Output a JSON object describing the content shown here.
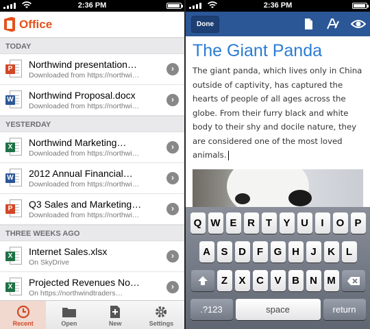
{
  "status_left": {
    "time": "2:36 PM"
  },
  "status_right": {
    "time": "2:36 PM"
  },
  "office": {
    "title": "Office",
    "brand_color": "#e4511b",
    "sections": [
      {
        "label": "TODAY",
        "items": [
          {
            "type": "powerpoint",
            "badge": "P",
            "title": "Northwind presentation…",
            "subtitle": "Downloaded from https://northwi…"
          },
          {
            "type": "word",
            "badge": "W",
            "title": "Northwind Proposal.docx",
            "subtitle": "Downloaded from https://northwi…"
          }
        ]
      },
      {
        "label": "YESTERDAY",
        "items": [
          {
            "type": "excel",
            "badge": "X",
            "title": "Northwind Marketing…",
            "subtitle": "Downloaded from https://northwi…"
          },
          {
            "type": "word",
            "badge": "W",
            "title": "2012 Annual Financial…",
            "subtitle": "Downloaded from https://northwi…"
          },
          {
            "type": "powerpoint",
            "badge": "P",
            "title": "Q3 Sales and Marketing…",
            "subtitle": "Downloaded from https://northwi…"
          }
        ]
      },
      {
        "label": "THREE WEEKS AGO",
        "items": [
          {
            "type": "excel",
            "badge": "X",
            "title": "Internet Sales.xlsx",
            "subtitle": "On SkyDrive"
          },
          {
            "type": "excel",
            "badge": "X",
            "title": "Projected Revenues No…",
            "subtitle": "On https://northwindtraders…"
          }
        ]
      }
    ],
    "tabs": [
      {
        "label": "Recent",
        "icon": "clock-icon",
        "active": true
      },
      {
        "label": "Open",
        "icon": "folder-icon",
        "active": false
      },
      {
        "label": "New",
        "icon": "new-document-icon",
        "active": false
      },
      {
        "label": "Settings",
        "icon": "gear-icon",
        "active": false
      }
    ]
  },
  "word": {
    "done_label": "Done",
    "toolbar_icons": [
      "document-icon",
      "font-format-icon",
      "eye-icon"
    ],
    "title": "The Giant Panda",
    "body": "The giant panda, which lives only in China outside of captivity, has captured the hearts of people of all ages across the globe. From their furry black and white body to their shy and docile nature, they are considered one of the most loved animals.",
    "header_color": "#2b5797",
    "title_color": "#2b7cd3"
  },
  "keyboard": {
    "row1": [
      "Q",
      "W",
      "E",
      "R",
      "T",
      "Y",
      "U",
      "I",
      "O",
      "P"
    ],
    "row2": [
      "A",
      "S",
      "D",
      "F",
      "G",
      "H",
      "J",
      "K",
      "L"
    ],
    "row3": [
      "Z",
      "X",
      "C",
      "V",
      "B",
      "N",
      "M"
    ],
    "mode_label": ".?123",
    "space_label": "space",
    "return_label": "return"
  }
}
